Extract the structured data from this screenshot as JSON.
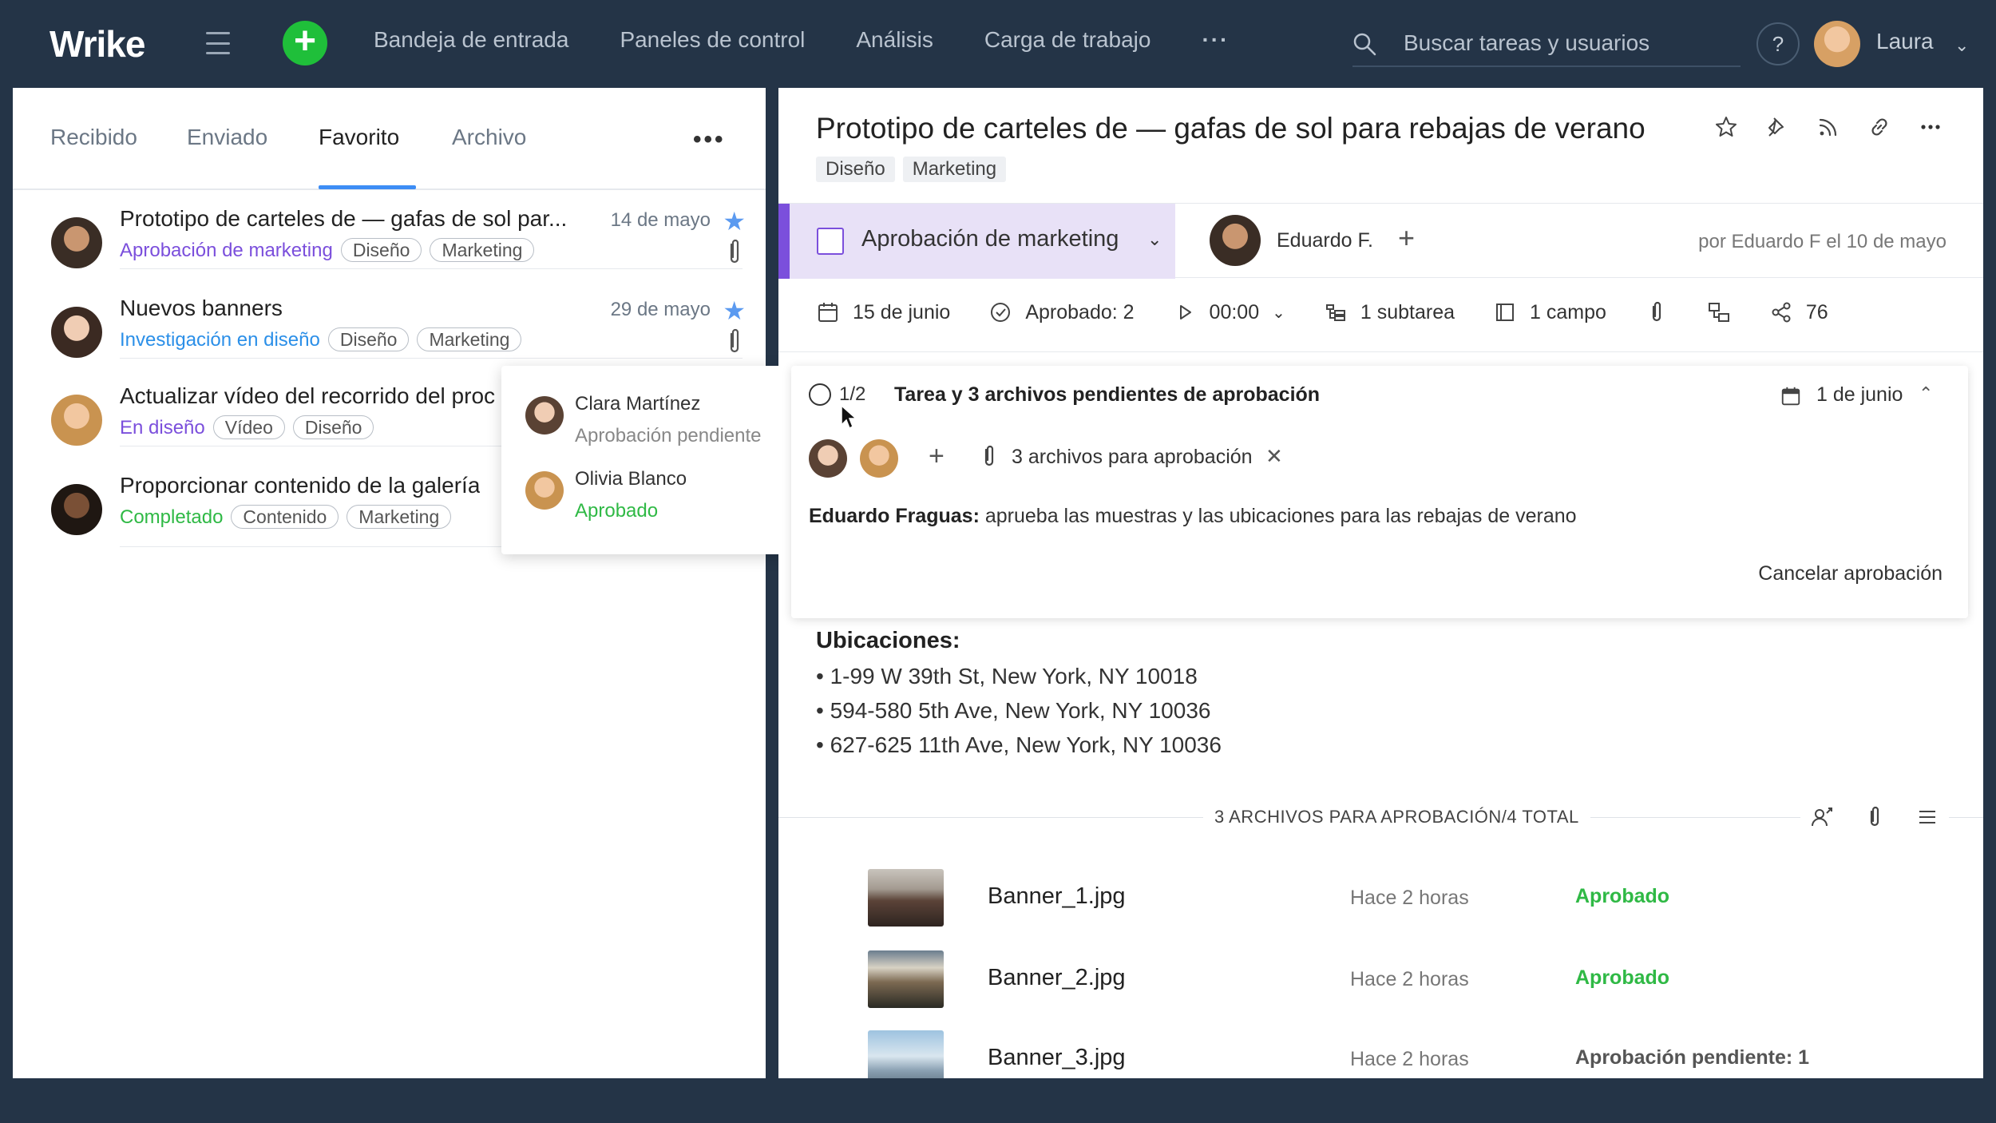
{
  "topbar": {
    "logo": "Wrike",
    "nav": [
      "Bandeja de entrada",
      "Paneles de control",
      "Análisis",
      "Carga de trabajo"
    ],
    "nav_more": "···",
    "search_placeholder": "Buscar tareas y usuarios",
    "help": "?",
    "user_name": "Laura"
  },
  "inbox": {
    "tabs": [
      "Recibido",
      "Enviado",
      "Favorito",
      "Archivo"
    ],
    "active_tab": "Favorito",
    "more": "•••",
    "tasks": [
      {
        "title": "Prototipo de carteles de — gafas de sol par...",
        "date": "14 de mayo",
        "status": "Aprobación de marketing",
        "status_color": "#7b4fdc",
        "tags": [
          "Diseño",
          "Marketing"
        ],
        "starred": true,
        "attachment": true
      },
      {
        "title": "Nuevos banners",
        "date": "29 de mayo",
        "status": "Investigación en diseño",
        "status_color": "#2b8fe8",
        "tags": [
          "Diseño",
          "Marketing"
        ],
        "starred": true,
        "attachment": true
      },
      {
        "title": "Actualizar vídeo del recorrido del proc",
        "date": "",
        "status": "En diseño",
        "status_color": "#7b4fdc",
        "tags": [
          "Vídeo",
          "Diseño"
        ],
        "starred": false,
        "attachment": false
      },
      {
        "title": "Proporcionar contenido de la galería",
        "date": "",
        "status": "Completado",
        "status_color": "#2fb945",
        "tags": [
          "Contenido",
          "Marketing"
        ],
        "starred": false,
        "attachment": false
      }
    ],
    "popover": [
      {
        "name": "Clara Martínez",
        "status": "Aprobación pendiente",
        "status_color": "#888888"
      },
      {
        "name": "Olivia Blanco",
        "status": "Aprobado",
        "status_color": "#2fb945"
      }
    ]
  },
  "task": {
    "title": "Prototipo de carteles de — gafas de sol para rebajas de verano",
    "tags": [
      "Diseño",
      "Marketing"
    ],
    "status": "Aprobación de marketing",
    "assignee": "Eduardo F.",
    "author": "por Eduardo F el 10 de mayo",
    "meta": {
      "due": "15 de junio",
      "approved": "Aprobado: 2",
      "timer": "00:00",
      "subtasks": "1 subtarea",
      "fields": "1 campo",
      "shares": "76"
    },
    "approval": {
      "count": "1/2",
      "title": "Tarea y 3 archivos pendientes de aprobación",
      "date": "1 de junio",
      "files": "3 archivos para aprobación",
      "author": "Eduardo Fraguas:",
      "description": " aprueba las muestras y las ubicaciones para las rebajas de verano",
      "cancel": "Cancelar aprobación"
    },
    "locations": {
      "title": "Ubicaciones:",
      "items": [
        "• 1-99 W 39th St, New York, NY 10018",
        "• 594-580 5th Ave, New York, NY 10036",
        "• 627-625 11th Ave, New York, NY 10036"
      ]
    },
    "files_header": "3 ARCHIVOS PARA APROBACIÓN/4 TOTAL",
    "files": [
      {
        "name": "Banner_1.jpg",
        "time": "Hace 2 horas",
        "status": "Aprobado",
        "status_color": "#2fb945"
      },
      {
        "name": "Banner_2.jpg",
        "time": "Hace 2 horas",
        "status": "Aprobado",
        "status_color": "#2fb945"
      },
      {
        "name": "Banner_3.jpg",
        "time": "Hace 2 horas",
        "status": "Aprobación pendiente: 1",
        "status_color": "#555555"
      }
    ]
  },
  "colors": {
    "accent": "#3d8df5",
    "brand_green": "#1fbf3a",
    "status_purple": "#7b4fdc",
    "topbar_bg": "#243447"
  }
}
